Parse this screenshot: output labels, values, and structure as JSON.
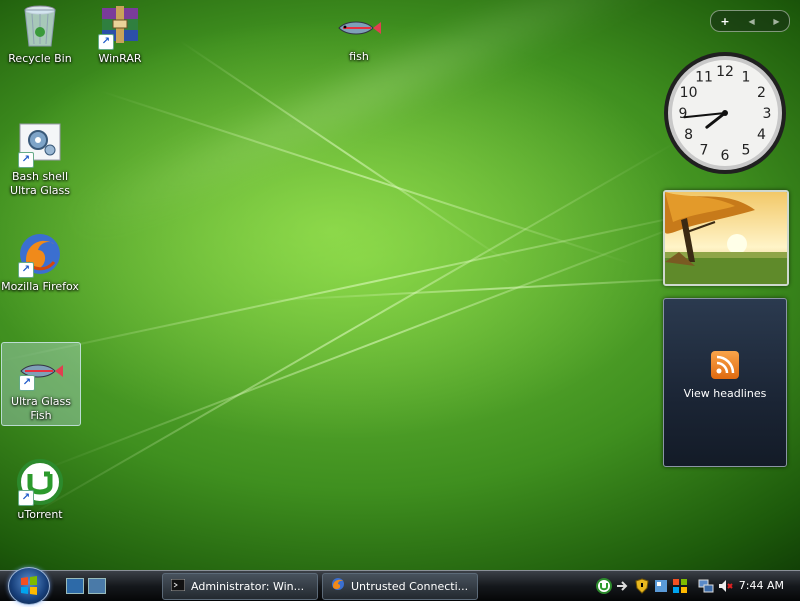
{
  "desktop": {
    "icons": [
      {
        "label": "Recycle Bin",
        "icon": "recycle-bin-icon"
      },
      {
        "label": "WinRAR",
        "icon": "winrar-icon"
      },
      {
        "label": "fish",
        "icon": "fish-icon"
      },
      {
        "label": "Bash shell Ultra Glass",
        "icon": "gear-icon"
      },
      {
        "label": "Mozilla Firefox",
        "icon": "firefox-icon"
      },
      {
        "label": "Ultra Glass Fish",
        "icon": "fish-icon"
      },
      {
        "label": "uTorrent",
        "icon": "utorrent-icon"
      }
    ]
  },
  "gadgets": {
    "sidebar_controls": {
      "add": "+",
      "prev": "◀",
      "next": "▶"
    },
    "clock": {
      "numbers": [
        "12",
        "1",
        "2",
        "3",
        "4",
        "5",
        "6",
        "7",
        "8",
        "9",
        "10",
        "11"
      ],
      "time_shown": "7:44"
    },
    "feed": {
      "label": "View headlines",
      "icon": "rss-icon"
    }
  },
  "taskbar": {
    "start_icon": "windows-logo-icon",
    "tasks": [
      {
        "label": "Administrator:  Win...",
        "icon": "console-icon"
      },
      {
        "label": "Untrusted Connecti...",
        "icon": "firefox-icon"
      }
    ],
    "tray": {
      "clock": "7:44 AM"
    }
  },
  "colors": {
    "wallpaper": "#4f9f28",
    "taskbar": "#15181c",
    "accent": "#5a8fd0"
  }
}
